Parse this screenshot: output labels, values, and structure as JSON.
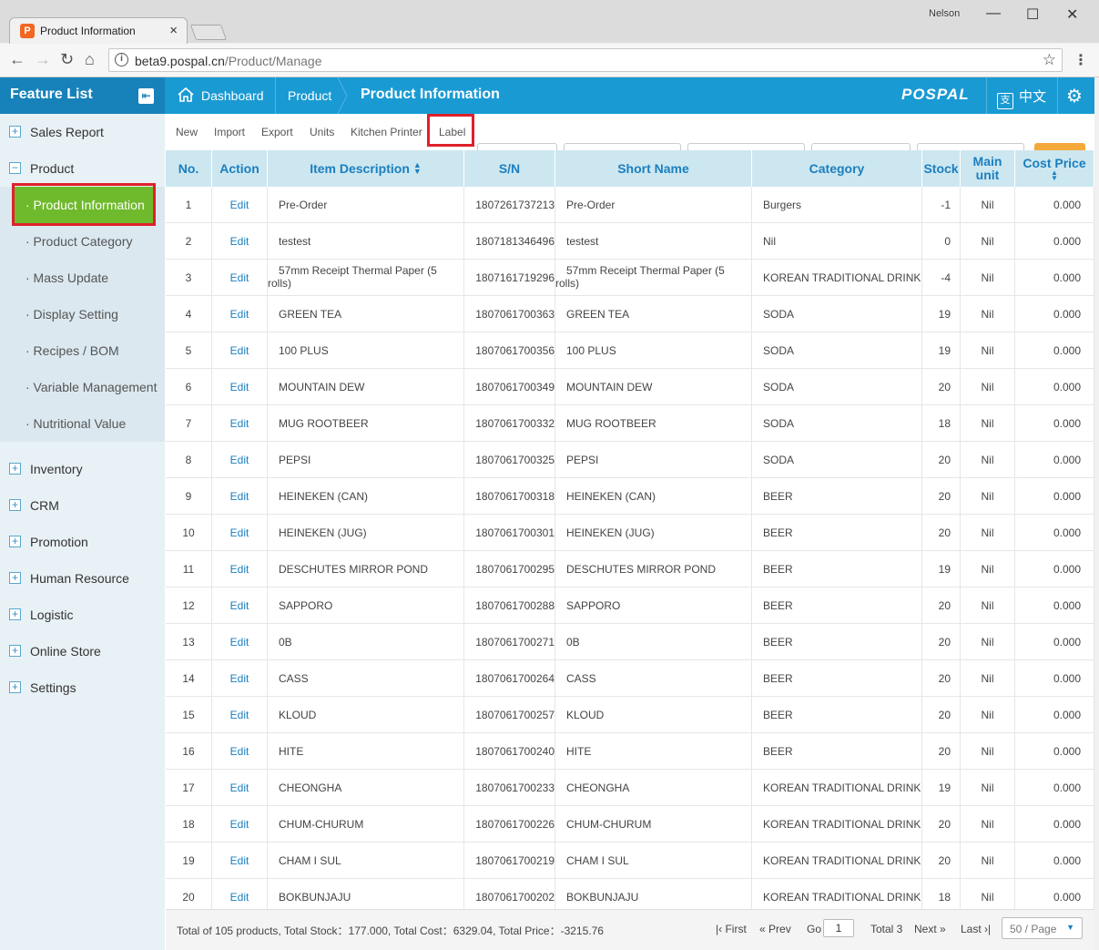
{
  "browser": {
    "tab_title": "Product Information",
    "tab_close": "×",
    "user_name": "Nelson",
    "url_host": "beta9.pospal.cn",
    "url_path": "/Product/Manage"
  },
  "header": {
    "feature_list": "Feature List",
    "breadcrumbs": [
      "Dashboard",
      "Product",
      "Product Information"
    ],
    "logo": "POSPAL",
    "language": "中文",
    "language_icon": "支"
  },
  "sidebar": {
    "items": [
      {
        "label": "Sales Report",
        "icon": "plus"
      },
      {
        "label": "Product",
        "icon": "minus"
      },
      {
        "label": "Inventory",
        "icon": "plus"
      },
      {
        "label": "CRM",
        "icon": "plus"
      },
      {
        "label": "Promotion",
        "icon": "plus"
      },
      {
        "label": "Human Resource",
        "icon": "plus"
      },
      {
        "label": "Logistic",
        "icon": "plus"
      },
      {
        "label": "Online Store",
        "icon": "plus"
      },
      {
        "label": "Settings",
        "icon": "plus"
      }
    ],
    "product_sub": [
      "· Product Information",
      "· Product Category",
      "· Mass Update",
      "· Display Setting",
      "· Recipes / BOM",
      "· Variable Management",
      "· Nutritional Value"
    ],
    "active_sub": "· Product Information"
  },
  "toolbar": {
    "buttons": [
      "New",
      "Import",
      "Export",
      "Units",
      "Kitchen Printer",
      "Label"
    ]
  },
  "table": {
    "columns": [
      "No.",
      "Action",
      "Item Description",
      "S/N",
      "Short Name",
      "Category",
      "Stock",
      "Main unit",
      "Cost Price"
    ],
    "rows": [
      {
        "no": "1",
        "action": "Edit",
        "desc": "Pre-Order",
        "sn": "1807261737213",
        "short": "Pre-Order",
        "cat": "Burgers",
        "stock": "-1",
        "unit": "Nil",
        "cost": "0.000"
      },
      {
        "no": "2",
        "action": "Edit",
        "desc": "testest",
        "sn": "1807181346496",
        "short": "testest",
        "cat": "Nil",
        "stock": "0",
        "unit": "Nil",
        "cost": "0.000"
      },
      {
        "no": "3",
        "action": "Edit",
        "desc": "57mm Receipt Thermal Paper (5 rolls)",
        "sn": "1807161719296",
        "short": "57mm Receipt Thermal Paper (5 rolls)",
        "cat": "KOREAN TRADITIONAL DRINK",
        "stock": "-4",
        "unit": "Nil",
        "cost": "0.000"
      },
      {
        "no": "4",
        "action": "Edit",
        "desc": "GREEN TEA",
        "sn": "1807061700363",
        "short": "GREEN TEA",
        "cat": "SODA",
        "stock": "19",
        "unit": "Nil",
        "cost": "0.000"
      },
      {
        "no": "5",
        "action": "Edit",
        "desc": "100 PLUS",
        "sn": "1807061700356",
        "short": "100 PLUS",
        "cat": "SODA",
        "stock": "19",
        "unit": "Nil",
        "cost": "0.000"
      },
      {
        "no": "6",
        "action": "Edit",
        "desc": "MOUNTAIN DEW",
        "sn": "1807061700349",
        "short": "MOUNTAIN DEW",
        "cat": "SODA",
        "stock": "20",
        "unit": "Nil",
        "cost": "0.000"
      },
      {
        "no": "7",
        "action": "Edit",
        "desc": "MUG ROOTBEER",
        "sn": "1807061700332",
        "short": "MUG ROOTBEER",
        "cat": "SODA",
        "stock": "18",
        "unit": "Nil",
        "cost": "0.000"
      },
      {
        "no": "8",
        "action": "Edit",
        "desc": "PEPSI",
        "sn": "1807061700325",
        "short": "PEPSI",
        "cat": "SODA",
        "stock": "20",
        "unit": "Nil",
        "cost": "0.000"
      },
      {
        "no": "9",
        "action": "Edit",
        "desc": "HEINEKEN (CAN)",
        "sn": "1807061700318",
        "short": "HEINEKEN (CAN)",
        "cat": "BEER",
        "stock": "20",
        "unit": "Nil",
        "cost": "0.000"
      },
      {
        "no": "10",
        "action": "Edit",
        "desc": "HEINEKEN (JUG)",
        "sn": "1807061700301",
        "short": "HEINEKEN (JUG)",
        "cat": "BEER",
        "stock": "20",
        "unit": "Nil",
        "cost": "0.000"
      },
      {
        "no": "11",
        "action": "Edit",
        "desc": "DESCHUTES MIRROR POND",
        "sn": "1807061700295",
        "short": "DESCHUTES MIRROR POND",
        "cat": "BEER",
        "stock": "19",
        "unit": "Nil",
        "cost": "0.000"
      },
      {
        "no": "12",
        "action": "Edit",
        "desc": "SAPPORO",
        "sn": "1807061700288",
        "short": "SAPPORO",
        "cat": "BEER",
        "stock": "20",
        "unit": "Nil",
        "cost": "0.000"
      },
      {
        "no": "13",
        "action": "Edit",
        "desc": "0B",
        "sn": "1807061700271",
        "short": "0B",
        "cat": "BEER",
        "stock": "20",
        "unit": "Nil",
        "cost": "0.000"
      },
      {
        "no": "14",
        "action": "Edit",
        "desc": "CASS",
        "sn": "1807061700264",
        "short": "CASS",
        "cat": "BEER",
        "stock": "20",
        "unit": "Nil",
        "cost": "0.000"
      },
      {
        "no": "15",
        "action": "Edit",
        "desc": "KLOUD",
        "sn": "1807061700257",
        "short": "KLOUD",
        "cat": "BEER",
        "stock": "20",
        "unit": "Nil",
        "cost": "0.000"
      },
      {
        "no": "16",
        "action": "Edit",
        "desc": "HITE",
        "sn": "1807061700240",
        "short": "HITE",
        "cat": "BEER",
        "stock": "20",
        "unit": "Nil",
        "cost": "0.000"
      },
      {
        "no": "17",
        "action": "Edit",
        "desc": "CHEONGHA",
        "sn": "1807061700233",
        "short": "CHEONGHA",
        "cat": "KOREAN TRADITIONAL DRINK",
        "stock": "19",
        "unit": "Nil",
        "cost": "0.000"
      },
      {
        "no": "18",
        "action": "Edit",
        "desc": "CHUM-CHURUM",
        "sn": "1807061700226",
        "short": "CHUM-CHURUM",
        "cat": "KOREAN TRADITIONAL DRINK",
        "stock": "20",
        "unit": "Nil",
        "cost": "0.000"
      },
      {
        "no": "19",
        "action": "Edit",
        "desc": "CHAM I SUL",
        "sn": "1807061700219",
        "short": "CHAM I SUL",
        "cat": "KOREAN TRADITIONAL DRINK",
        "stock": "20",
        "unit": "Nil",
        "cost": "0.000"
      },
      {
        "no": "20",
        "action": "Edit",
        "desc": "BOKBUNJAJU",
        "sn": "1807061700202",
        "short": "BOKBUNJAJU",
        "cat": "KOREAN TRADITIONAL DRINK",
        "stock": "18",
        "unit": "Nil",
        "cost": "0.000"
      }
    ]
  },
  "footer": {
    "summary": "Total of 105 products, Total Stock：177.000, Total Cost：6329.04, Total Price：-3215.76",
    "first": "First",
    "prev": "Prev",
    "go": "Go",
    "page": "1",
    "total_pages": "Total 3",
    "next": "Next",
    "last": "Last",
    "page_size": "50 / Page"
  },
  "colors": {
    "header_blue": "#1a9ad3",
    "active_green": "#6fba2c",
    "highlight_red": "#e0202a",
    "link_blue": "#1a7fbf"
  }
}
